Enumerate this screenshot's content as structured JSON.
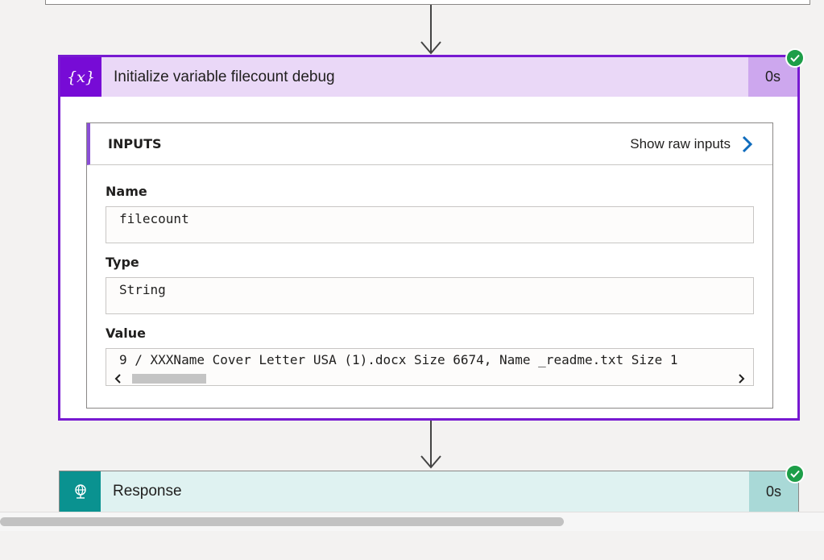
{
  "card": {
    "icon_text": "{x}",
    "title": "Initialize variable filecount debug",
    "duration": "0s",
    "status": "succeeded",
    "accent_color": "#770bd6"
  },
  "inputs": {
    "title": "INPUTS",
    "show_raw_label": "Show raw inputs",
    "fields": {
      "name": {
        "label": "Name",
        "value": "filecount"
      },
      "type": {
        "label": "Type",
        "value": "String"
      },
      "value": {
        "label": "Value",
        "value": "9 / XXXName Cover Letter USA (1).docx Size 6674, Name _readme.txt Size 1"
      }
    }
  },
  "response": {
    "icon": "globe-network-icon",
    "title": "Response",
    "duration": "0s",
    "status": "succeeded",
    "accent_color": "#0a9290"
  },
  "icons": {
    "arrow": "arrow-down-icon",
    "check": "check-circle-icon",
    "chevron": "chevron-right-icon"
  }
}
